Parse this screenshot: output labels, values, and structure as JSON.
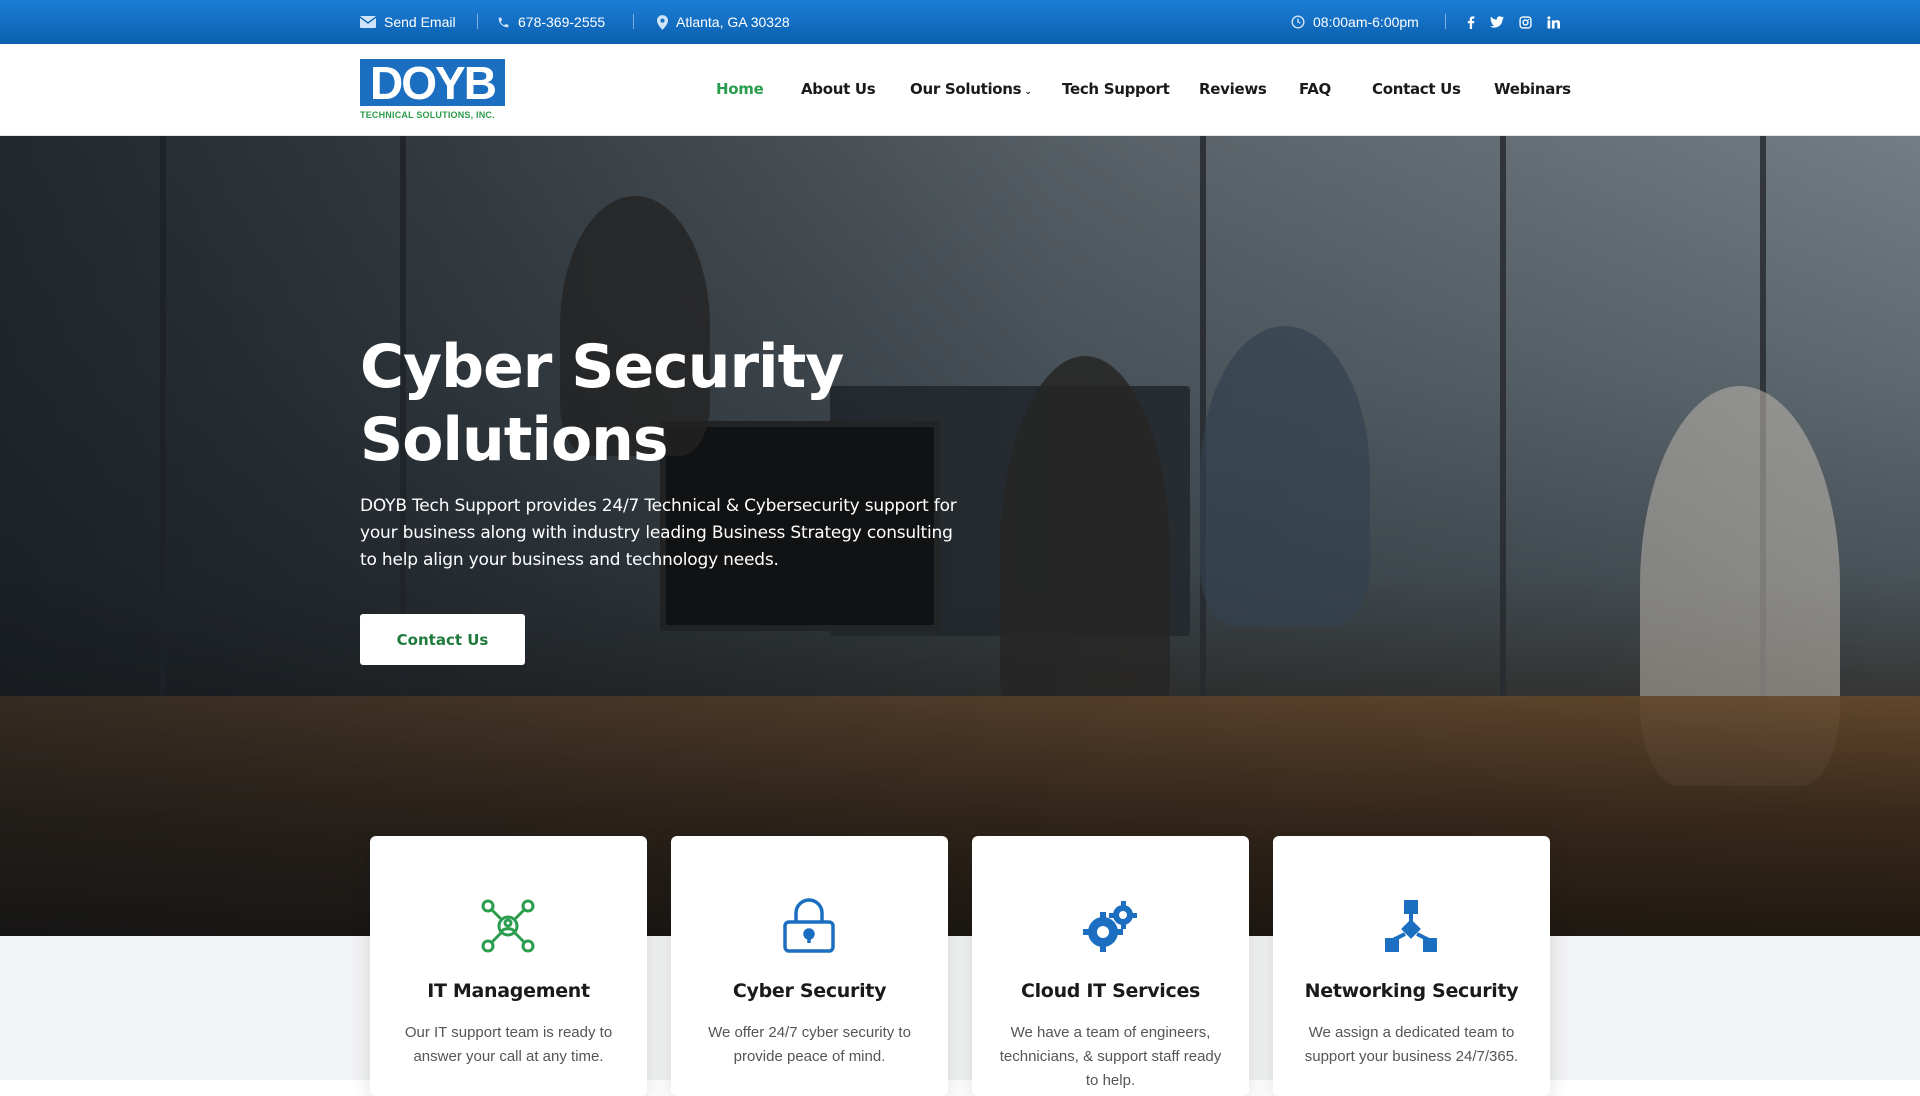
{
  "topbar": {
    "email_label": "Send Email",
    "phone": "678-369-2555",
    "address": "Atlanta, GA 30328",
    "hours": "08:00am-6:00pm",
    "social": [
      "facebook-icon",
      "twitter-icon",
      "instagram-icon",
      "linkedin-icon"
    ]
  },
  "logo": {
    "text_main": "DOYB",
    "subtext": "TECHNICAL SOLUTIONS, INC."
  },
  "nav": {
    "items": [
      {
        "label": "Home",
        "active": true
      },
      {
        "label": "About Us"
      },
      {
        "label": "Our Solutions",
        "dropdown": true
      },
      {
        "label": "Tech Support"
      },
      {
        "label": "Reviews"
      },
      {
        "label": "FAQ"
      },
      {
        "label": "Contact Us"
      },
      {
        "label": "Webinars"
      }
    ]
  },
  "hero": {
    "title_line1": "Cyber Security",
    "title_line2": "Solutions",
    "description": "DOYB Tech Support provides 24/7 Technical & Cybersecurity support for your business along with industry leading Business Strategy consulting to help align your business and technology needs.",
    "cta_label": "Contact Us"
  },
  "cards": [
    {
      "title": "IT Management",
      "text": "Our IT support team is ready to answer your call at any time.",
      "icon": "network-user-icon"
    },
    {
      "title": "Cyber Security",
      "text": "We offer 24/7 cyber security to provide peace of mind.",
      "icon": "lock-icon"
    },
    {
      "title": "Cloud IT Services",
      "text": "We have a team of engineers, technicians, & support staff ready to help.",
      "icon": "gears-icon"
    },
    {
      "title": "Networking Security",
      "text": "We assign a dedicated team to support your business 24/7/365.",
      "icon": "network-diagram-icon"
    }
  ],
  "colors": {
    "topbar": "#0c5fae",
    "accent_green": "#2a9d4f",
    "brand_blue": "#1c6fc0"
  }
}
